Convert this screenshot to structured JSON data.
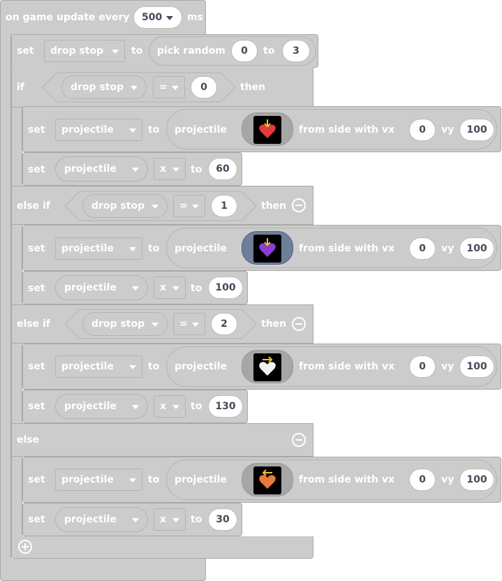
{
  "event": {
    "label": "on game update every",
    "interval": "500",
    "unit": "ms"
  },
  "assign_random": {
    "set": "set",
    "var": "drop stop",
    "to": "to",
    "fn": "pick random",
    "min": "0",
    "to2": "to",
    "max": "3"
  },
  "kw": {
    "if": "if",
    "else_if": "else if",
    "else": "else",
    "then": "then",
    "set": "set",
    "to": "to",
    "projectile": "projectile",
    "from_side": "from side with vx",
    "vy": "vy",
    "eq": "=",
    "prop_x": "x"
  },
  "branches": [
    {
      "var": "drop stop",
      "value": "0",
      "sprite": "red-heart-arrow-down",
      "vx": "0",
      "vy": "100",
      "target": "projectile",
      "x": "60"
    },
    {
      "var": "drop stop",
      "value": "1",
      "sprite": "purple-heart-arrow-down",
      "vx": "0",
      "vy": "100",
      "target": "projectile",
      "x": "100"
    },
    {
      "var": "drop stop",
      "value": "2",
      "sprite": "white-heart-arrow-right",
      "vx": "0",
      "vy": "100",
      "target": "projectile",
      "x": "130"
    },
    {
      "sprite": "orange-heart-arrow-left",
      "vx": "0",
      "vy": "100",
      "target": "projectile",
      "x": "30"
    }
  ],
  "colors": {
    "block": "#cccccc",
    "border": "#a8a8a8",
    "text": "#ffffff",
    "field": "#ffffff",
    "field_text": "#444b5a",
    "selected": "#6f7f97"
  }
}
